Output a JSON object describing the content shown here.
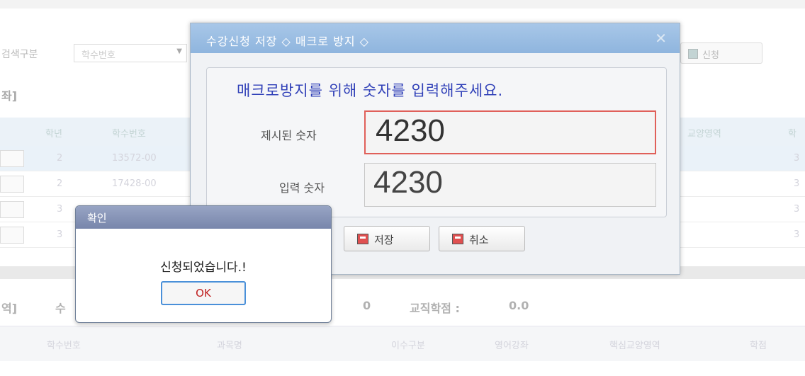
{
  "background": {
    "search_label": "검색구분",
    "search_select_value": "학수번호",
    "apply_button_label": "신청",
    "section_title": "좌]",
    "columns": [
      "학년",
      "학수번호",
      "교양영역",
      "학"
    ],
    "rows": [
      {
        "year": "2",
        "code": "13572-00",
        "credit": "3"
      },
      {
        "year": "2",
        "code": "17428-00",
        "credit": "3"
      },
      {
        "year": "3",
        "code": "",
        "credit": "3"
      },
      {
        "year": "3",
        "code": "",
        "credit": "3"
      }
    ],
    "summary": {
      "left_label": "역]",
      "left_value": "수",
      "mid_value": "0",
      "teaching_label": "교직학점 :",
      "teaching_value": "0.0"
    },
    "columns2": [
      "학수번호",
      "과목명",
      "이수구분",
      "영어강좌",
      "핵심교양영역",
      "학점"
    ]
  },
  "macro_dialog": {
    "title": "수강신청 저장    ◇ 매크로 방지 ◇",
    "close_glyph": "✕",
    "instruction": "매크로방지를 위해 숫자를 입력해주세요.",
    "shown_label": "제시된 숫자",
    "shown_number": "4230",
    "input_label": "입력 숫자",
    "input_number": "4230",
    "save_label": "저장",
    "cancel_label": "취소"
  },
  "confirm_alert": {
    "title": "확인",
    "message": "신청되었습니다.!",
    "ok_label": "OK"
  },
  "colors": {
    "instruction_text": "#3040b8",
    "shown_box_border": "#e0605a",
    "ok_text": "#c02020",
    "ok_border": "#4a90d9"
  }
}
